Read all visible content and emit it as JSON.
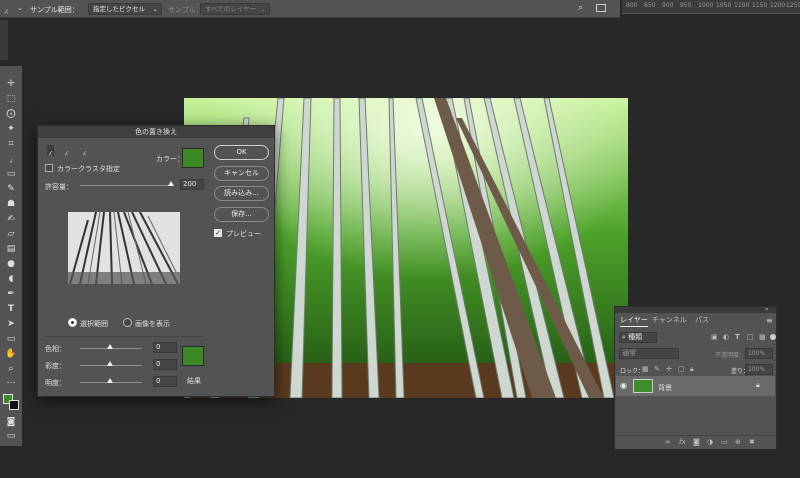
{
  "options_bar": {
    "tool_icon": "eyedropper-icon",
    "sample_size_label": "サンプル範囲：",
    "sample_size_value": "指定したピクセル",
    "sample_label": "サンプル：",
    "sample_value": "すべてのレイヤー"
  },
  "ruler": {
    "ticks": [
      "800",
      "850",
      "900",
      "950",
      "1000",
      "1050",
      "1100",
      "1150",
      "1200",
      "1250"
    ]
  },
  "dialog": {
    "title": "色の置き換え",
    "color_label": "カラー：",
    "color_swatch": "#3c8a25",
    "localized_clusters_label": "カラークラスタ指定",
    "localized_clusters_checked": false,
    "fuzziness_label": "許容量：",
    "fuzziness_value": "200",
    "buttons": {
      "ok": "OK",
      "cancel": "キャンセル",
      "load": "読み込み...",
      "save": "保存..."
    },
    "preview_label": "プレビュー",
    "preview_checked": true,
    "radio_selection": "選択範囲",
    "radio_image": "画像を表示",
    "hue_label": "色相：",
    "hue_value": "0",
    "saturation_label": "彩度：",
    "saturation_value": "0",
    "lightness_label": "明度：",
    "lightness_value": "0",
    "result_label": "結果",
    "result_swatch": "#3c8a25"
  },
  "layers_panel": {
    "tabs": [
      "レイヤー",
      "チャンネル",
      "パス"
    ],
    "filter_placeholder": "種類",
    "blend_mode": "通常",
    "opacity_label": "不透明度：",
    "opacity_value": "100%",
    "lock_label": "ロック：",
    "fill_label": "塗り：",
    "fill_value": "100%",
    "layer_name": "背景"
  }
}
